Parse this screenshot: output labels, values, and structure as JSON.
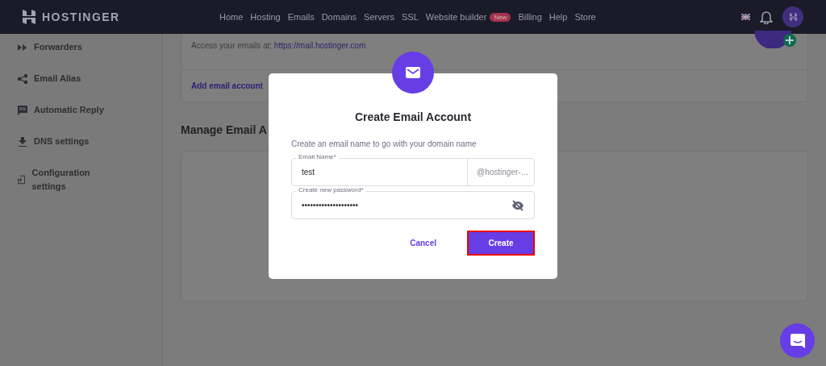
{
  "brand": "HOSTINGER",
  "nav": [
    {
      "label": "Home"
    },
    {
      "label": "Hosting"
    },
    {
      "label": "Emails"
    },
    {
      "label": "Domains"
    },
    {
      "label": "Servers"
    },
    {
      "label": "SSL"
    },
    {
      "label": "Website builder",
      "badge": "New"
    },
    {
      "label": "Billing"
    },
    {
      "label": "Help"
    },
    {
      "label": "Store"
    }
  ],
  "sidebar": {
    "items": [
      {
        "label": "Forwarders",
        "kind": "forward"
      },
      {
        "label": "Email Alias",
        "kind": "share"
      },
      {
        "label": "Automatic Reply",
        "kind": "chat"
      },
      {
        "label": "DNS settings",
        "kind": "download"
      },
      {
        "label": "Configuration settings",
        "kind": "config"
      }
    ]
  },
  "access": {
    "text": "Access your emails at:",
    "link": "https://mail.hostinger.com"
  },
  "add_link": "Add email account",
  "section_title": "Manage Email A",
  "dialog": {
    "title": "Create Email Account",
    "subtitle": "Create an email name to go with your domain name",
    "fields": [
      {
        "label": "Email Name*",
        "value": "test",
        "suffix": "@hostinger-…",
        "kind": "text"
      },
      {
        "label": "Create new password*",
        "value": "••••••••••••••••••••",
        "kind": "password"
      }
    ],
    "buttons": [
      {
        "label": "Cancel",
        "kind": "text"
      },
      {
        "label": "Create",
        "kind": "primary"
      }
    ]
  }
}
